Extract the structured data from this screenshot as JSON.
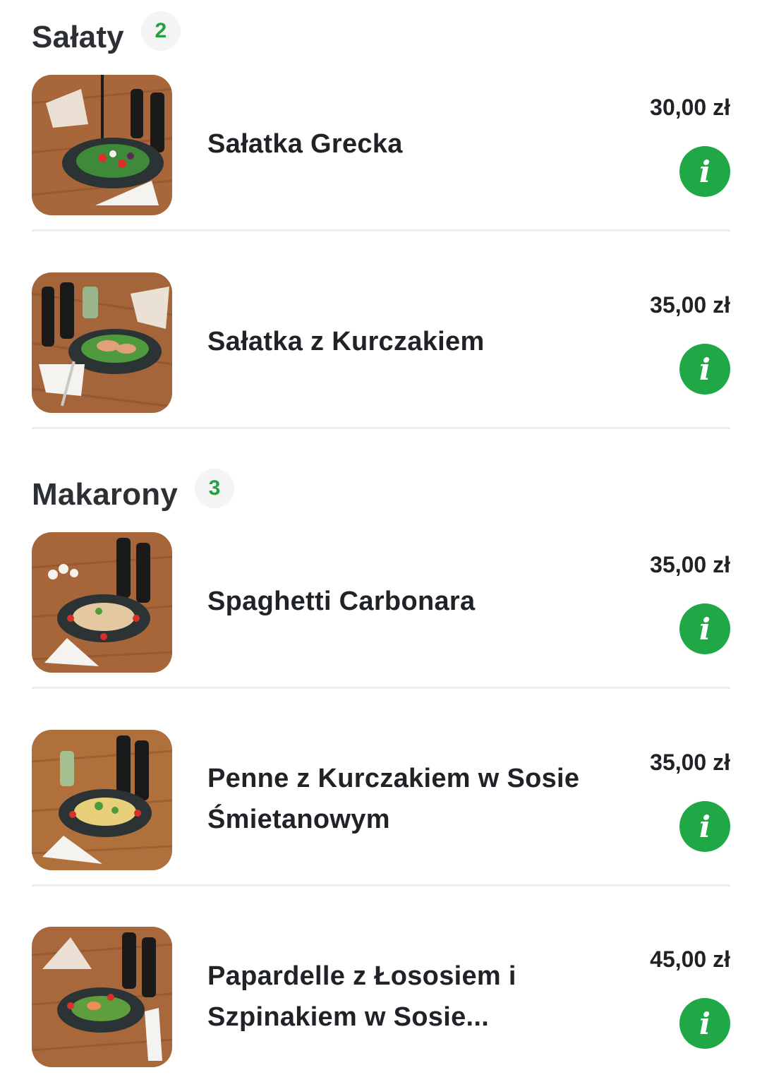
{
  "sections": [
    {
      "title": "Sałaty",
      "count": "2",
      "items": [
        {
          "name": "Sałatka Grecka",
          "price": "30,00 zł",
          "info_label": "i",
          "image_icon": "greek-salad-photo"
        },
        {
          "name": "Sałatka z Kurczakiem",
          "price": "35,00 zł",
          "info_label": "i",
          "image_icon": "chicken-salad-photo"
        }
      ]
    },
    {
      "title": "Makarony",
      "count": "3",
      "items": [
        {
          "name": "Spaghetti Carbonara",
          "price": "35,00 zł",
          "info_label": "i",
          "image_icon": "spaghetti-carbonara-photo"
        },
        {
          "name": "Penne z Kurczakiem w Sosie Śmietanowym",
          "price": "35,00 zł",
          "info_label": "i",
          "image_icon": "penne-chicken-photo"
        },
        {
          "name": "Papardelle z Łososiem i Szpinakiem w Sosie...",
          "price": "45,00 zł",
          "info_label": "i",
          "image_icon": "papardelle-salmon-photo"
        }
      ]
    }
  ],
  "colors": {
    "accent": "#1fa845",
    "badge_text": "#21a13f",
    "badge_bg": "#f3f4f3",
    "divider": "#eceded",
    "wood": "#a8673a"
  }
}
